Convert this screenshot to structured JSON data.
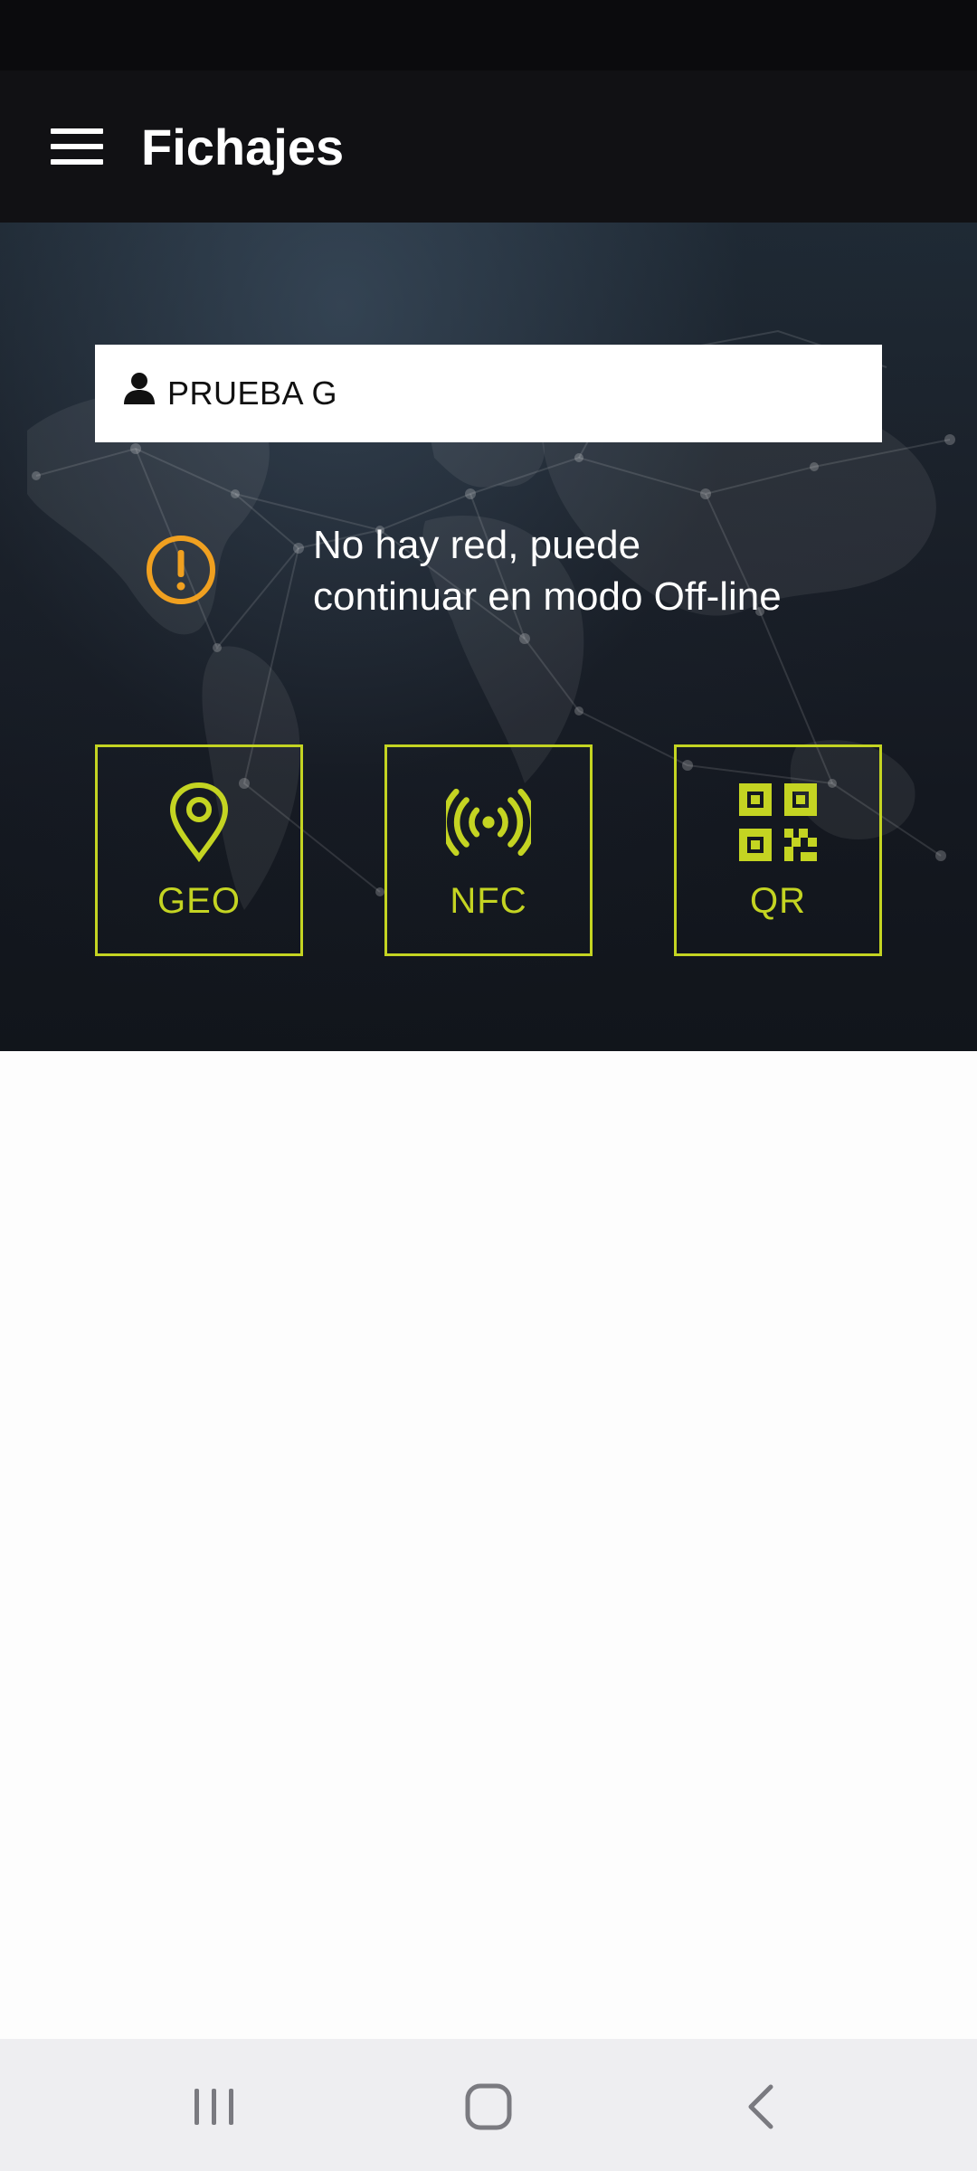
{
  "app_bar": {
    "title": "Fichajes",
    "menu_icon": "hamburger-menu-icon"
  },
  "user": {
    "name": "PRUEBA G",
    "icon": "person-icon"
  },
  "network_warning": {
    "icon": "exclamation-circle-icon",
    "line1": "No hay red, puede",
    "line2": "continuar en modo Off-line"
  },
  "actions": [
    {
      "label": "GEO",
      "icon": "map-pin-icon"
    },
    {
      "label": "NFC",
      "icon": "nfc-signal-icon"
    },
    {
      "label": "QR",
      "icon": "qr-code-icon"
    }
  ],
  "nav_bar": {
    "recents_icon": "recents-icon",
    "home_icon": "home-icon",
    "back_icon": "back-icon"
  },
  "colors": {
    "accent": "#c4d422",
    "warning": "#f0a020",
    "app_bar_bg": "#111114",
    "status_bar_bg": "#0b0b0d",
    "nav_bar_bg": "#eeeef1"
  }
}
